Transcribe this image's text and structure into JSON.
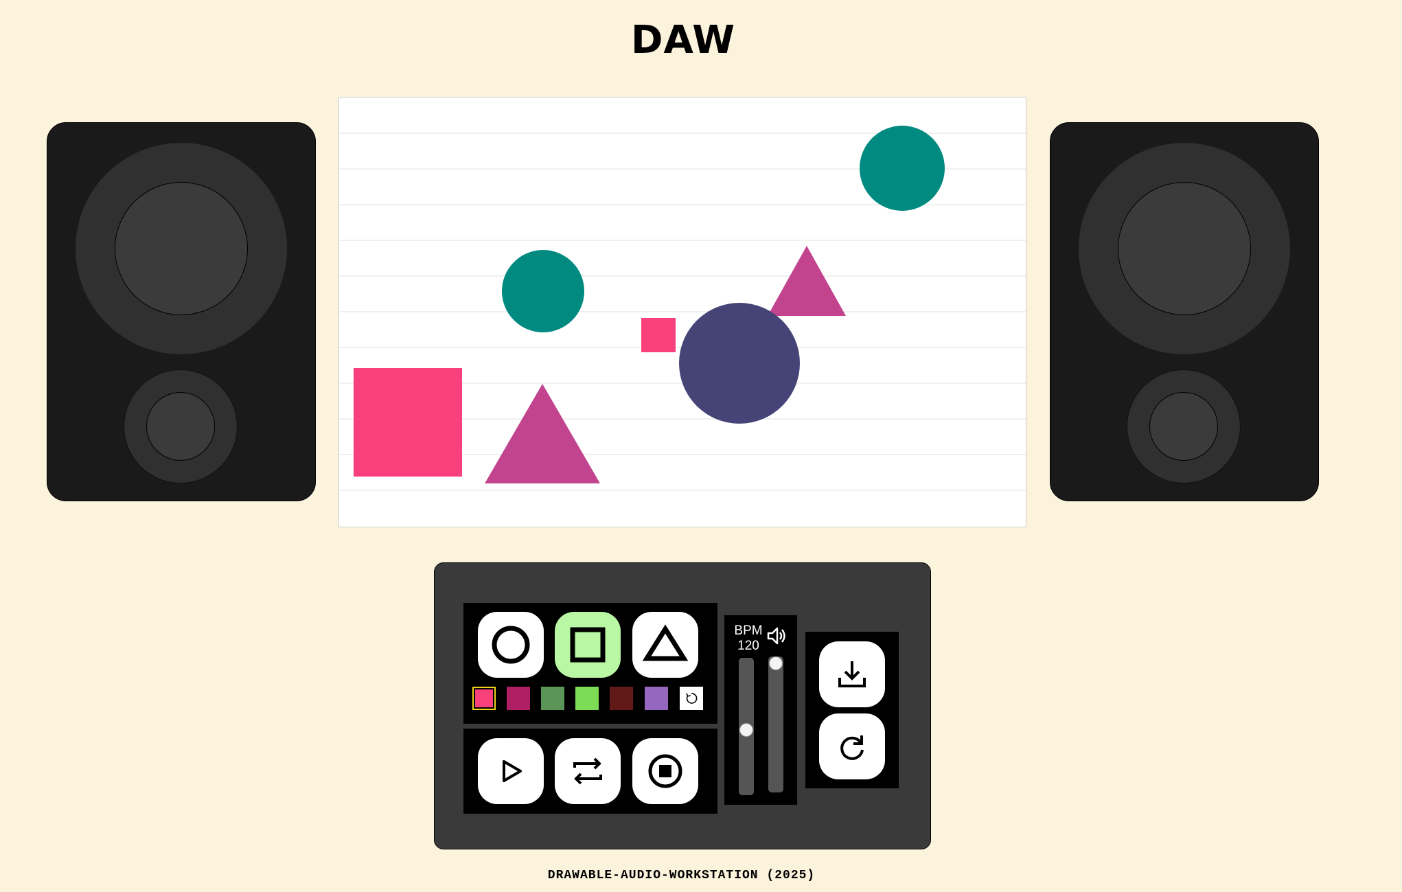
{
  "app": {
    "title": "DAW",
    "footer": "DRAWABLE-AUDIO-WORKSTATION (2025)"
  },
  "canvas": {
    "background": "#ffffff",
    "line_color": "#e0e0e0",
    "shapes": [
      {
        "type": "circle",
        "color": "#008a80"
      },
      {
        "type": "circle",
        "color": "#008a80"
      },
      {
        "type": "triangle",
        "color": "#c2448f"
      },
      {
        "type": "square",
        "color": "#f8407c"
      },
      {
        "type": "circle",
        "color": "#464476"
      },
      {
        "type": "square",
        "color": "#f8407c"
      },
      {
        "type": "triangle",
        "color": "#c2448f"
      }
    ]
  },
  "toolbar": {
    "shape_tools": [
      {
        "name": "circle",
        "icon": "circle-icon",
        "active": false
      },
      {
        "name": "square",
        "icon": "square-icon",
        "active": true
      },
      {
        "name": "triangle",
        "icon": "triangle-icon",
        "active": false
      }
    ],
    "colors": [
      {
        "hex": "#f8407c",
        "selected": true
      },
      {
        "hex": "#b01f63",
        "selected": false
      },
      {
        "hex": "#5c9558",
        "selected": false
      },
      {
        "hex": "#7ddc56",
        "selected": false
      },
      {
        "hex": "#621a19",
        "selected": false
      },
      {
        "hex": "#9567be",
        "selected": false
      }
    ],
    "transport": [
      {
        "name": "play",
        "icon": "play-icon"
      },
      {
        "name": "loop",
        "icon": "loop-icon"
      },
      {
        "name": "stop",
        "icon": "stop-icon"
      }
    ],
    "bpm_label": "BPM",
    "bpm_value": "120",
    "tempo_level": 0.47,
    "volume_level": 1.0,
    "actions": [
      {
        "name": "download",
        "icon": "download-icon"
      },
      {
        "name": "reset",
        "icon": "redo-icon"
      }
    ],
    "accent_active": "#b9f7a5",
    "selected_border": "#f1d21c"
  }
}
